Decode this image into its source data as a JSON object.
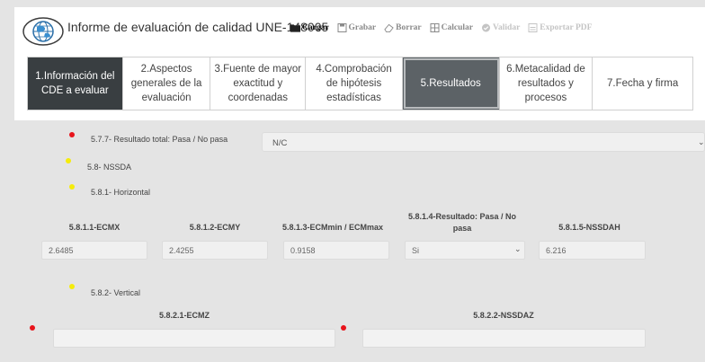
{
  "header": {
    "title": "Informe de evaluación de calidad UNE-148005",
    "toolbar": [
      {
        "label": "Cargar",
        "icon": "folder-icon",
        "state": "active"
      },
      {
        "label": "Grabar",
        "icon": "save-icon",
        "state": "muted"
      },
      {
        "label": "Borrar",
        "icon": "eraser-icon",
        "state": "muted"
      },
      {
        "label": "Calcular",
        "icon": "calculator-icon",
        "state": "muted"
      },
      {
        "label": "Validar",
        "icon": "check-circle-icon",
        "state": "disabled"
      },
      {
        "label": "Exportar PDF",
        "icon": "file-pdf-icon",
        "state": "disabled"
      }
    ]
  },
  "tabs": [
    {
      "label": "1.Información del CDE a evaluar",
      "lines": [
        "1.Información del",
        "CDE a evaluar"
      ],
      "state": "dark"
    },
    {
      "label": "2.Aspectos generales de la evaluación",
      "lines": [
        "2.Aspectos",
        "generales de la",
        "evaluación"
      ],
      "state": "normal"
    },
    {
      "label": "3.Fuente de mayor exactitud y coordenadas",
      "lines": [
        "3.Fuente de mayor",
        "exactitud y",
        "coordenadas"
      ],
      "state": "normal"
    },
    {
      "label": "4.Comprobación de hipótesis estadísticas",
      "lines": [
        "4.Comprobación",
        "de hipótesis",
        "estadísticas"
      ],
      "state": "normal"
    },
    {
      "label": "5.Resultados",
      "lines": [
        "5.Resultados"
      ],
      "state": "selected"
    },
    {
      "label": "6.Metacalidad de resultados y procesos",
      "lines": [
        "6.Metacalidad de",
        "resultados y",
        "procesos"
      ],
      "state": "normal"
    },
    {
      "label": "7.Fecha y firma",
      "lines": [
        "7.Fecha y firma"
      ],
      "state": "normal"
    }
  ],
  "form": {
    "total_result": {
      "label": "5.7.7- Resultado total: Pasa / No pasa",
      "value": "N/C"
    },
    "nssda": {
      "label": "5.8- NSSDA"
    },
    "horizontal": {
      "label": "5.8.1- Horizontal",
      "fields": [
        {
          "label": "5.8.1.1-ECMX",
          "value": "2.6485"
        },
        {
          "label": "5.8.1.2-ECMY",
          "value": "2.4255"
        },
        {
          "label": "5.8.1.3-ECMmin / ECMmax",
          "value": "0.9158"
        },
        {
          "label": "5.8.1.4-Resultado: Pasa / No pasa",
          "label_lines": [
            "5.8.1.4-Resultado: Pasa / No",
            "pasa"
          ],
          "value": "Si"
        },
        {
          "label": "5.8.1.5-NSSDAH",
          "value": "6.216"
        }
      ]
    },
    "vertical": {
      "label": "5.8.2- Vertical",
      "fields": [
        {
          "label": "5.8.2.1-ECMZ",
          "value": ""
        },
        {
          "label": "5.8.2.2-NSSDAZ",
          "value": ""
        }
      ]
    }
  },
  "colors": {
    "required_dot": "#e8141b",
    "section_dot": "#f5ec0b",
    "tab_dark": "#393e41",
    "tab_selected": "#5c6266",
    "page_background": "#e4e4e4"
  }
}
